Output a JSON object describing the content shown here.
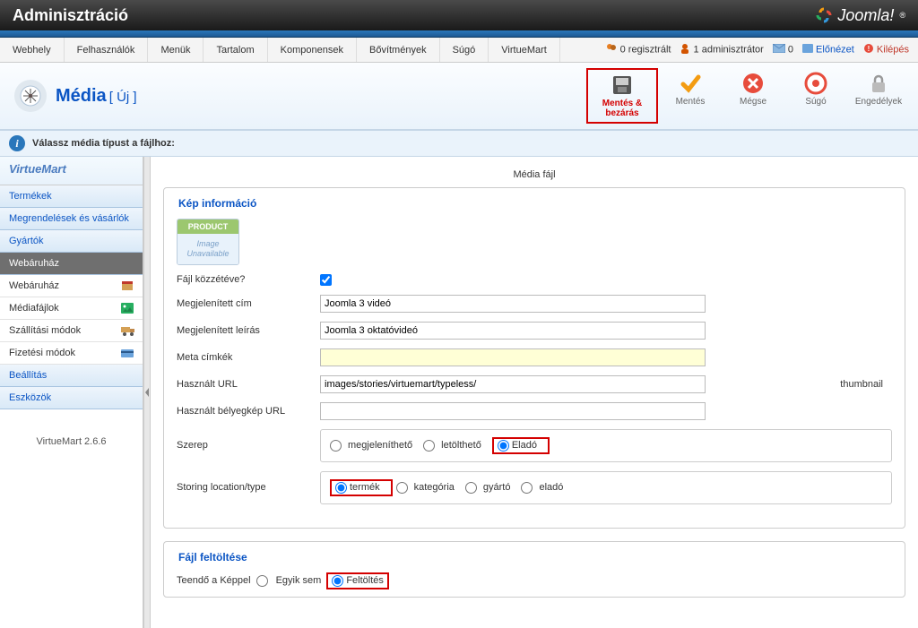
{
  "topbar": {
    "title": "Adminisztráció",
    "brand": "Joomla!"
  },
  "mainmenu": {
    "items": [
      "Webhely",
      "Felhasználók",
      "Menük",
      "Tartalom",
      "Komponensek",
      "Bővítmények",
      "Súgó",
      "VirtueMart"
    ]
  },
  "status": {
    "registered_count": "0",
    "registered_label": "regisztrált",
    "admin_count": "1",
    "admin_label": "adminisztrátor",
    "msg_count": "0",
    "preview": "Előnézet",
    "logout": "Kilépés"
  },
  "page": {
    "title": "Média",
    "subtitle": "[ Új ]"
  },
  "toolbar": {
    "save_close": "Mentés & bezárás",
    "save": "Mentés",
    "cancel": "Mégse",
    "help": "Súgó",
    "permissions": "Engedélyek"
  },
  "infobar": {
    "text": "Válassz média típust a fájlhoz:"
  },
  "sidebar": {
    "logo": "VirtueMart",
    "sections": {
      "products": "Termékek",
      "orders": "Megrendelések és vásárlók",
      "manufacturers": "Gyártók",
      "shop": "Webáruház"
    },
    "subitems": {
      "shop": "Webáruház",
      "media": "Médiafájlok",
      "shipping": "Szállítási módok",
      "payment": "Fizetési módok"
    },
    "settings": "Beállítás",
    "tools": "Eszközök",
    "version": "VirtueMart 2.6.6"
  },
  "content": {
    "section_title": "Média fájl",
    "image_info_legend": "Kép információ",
    "thumb": {
      "head": "PRODUCT",
      "line1": "Image",
      "line2": "Unavailable"
    },
    "labels": {
      "published": "Fájl közzétéve?",
      "title": "Megjelenített cím",
      "desc": "Megjelenített leírás",
      "meta": "Meta címkék",
      "url": "Használt URL",
      "thumb_url": "Használt bélyegkép URL",
      "role": "Szerep",
      "storing": "Storing location/type",
      "thumbnail_suffix": "thumbnail"
    },
    "values": {
      "title": "Joomla 3 videó",
      "desc": "Joomla 3 oktatóvideó",
      "meta": "",
      "url": "images/stories/virtuemart/typeless/",
      "thumb_url": ""
    },
    "role_options": {
      "displayable": "megjeleníthető",
      "downloadable": "letölthető",
      "forsale": "Eladó"
    },
    "storing_options": {
      "product": "termék",
      "category": "kategória",
      "manufacturer": "gyártó",
      "vendor": "eladó"
    },
    "upload_legend": "Fájl feltöltése",
    "upload_label": "Teendő a Képpel",
    "upload_options": {
      "none": "Egyik sem",
      "upload": "Feltöltés"
    }
  }
}
